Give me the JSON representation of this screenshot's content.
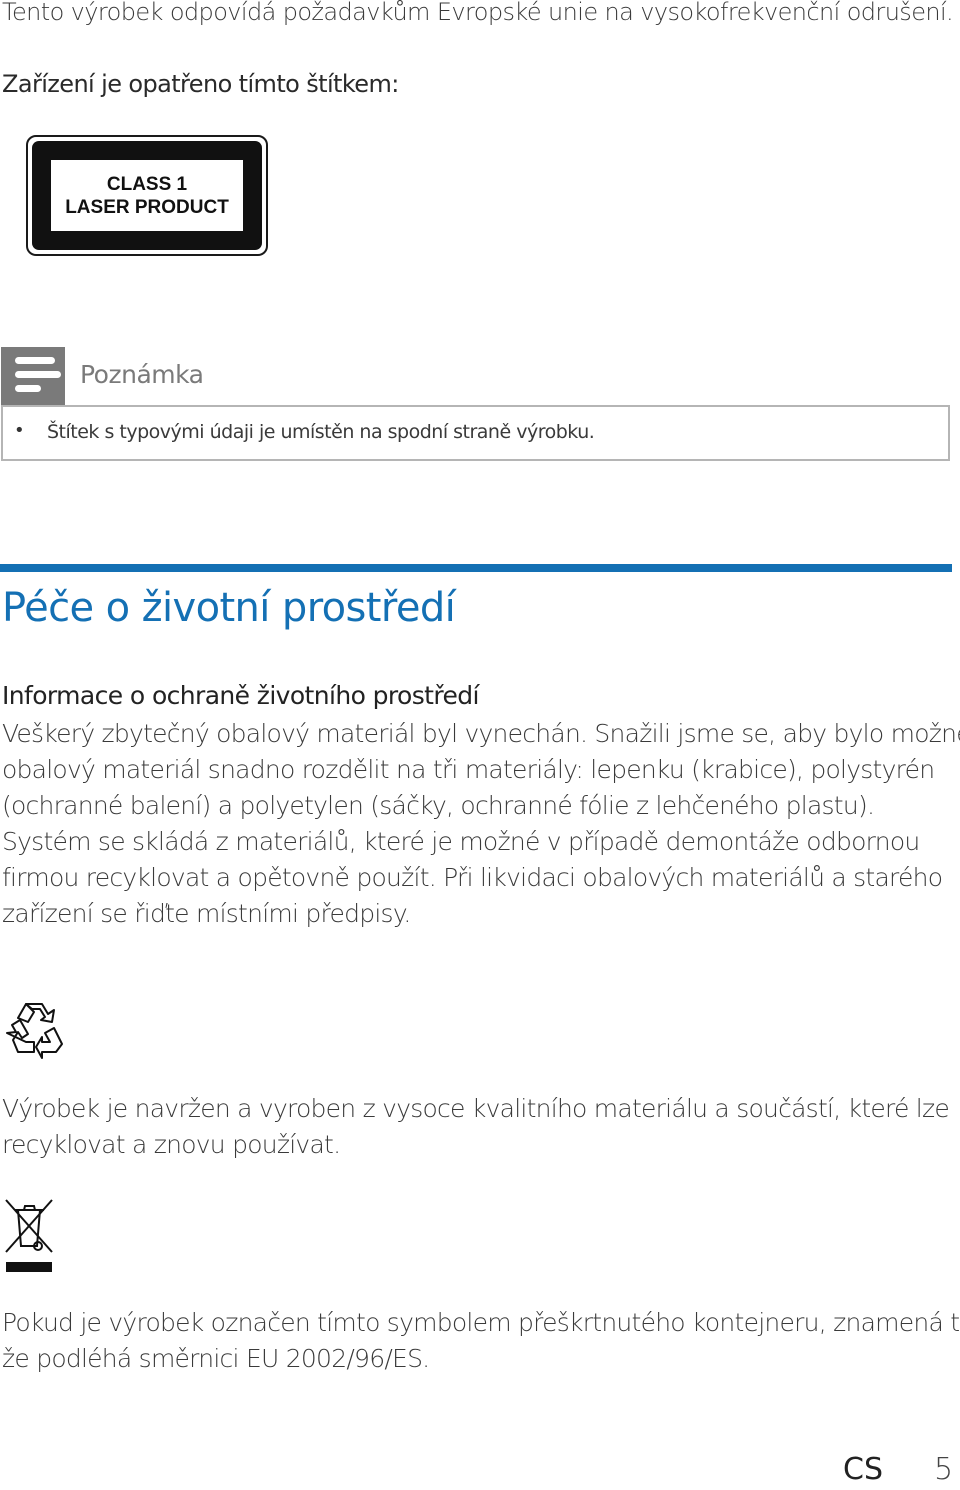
{
  "intro": {
    "emc_statement": "Tento výrobek odpovídá požadavkům Evropské unie na vysokofrekvenční odrušení.",
    "label_statement": "Zařízení je opatřeno tímto štítkem:"
  },
  "laser_label": {
    "line1": "CLASS 1",
    "line2": "LASER PRODUCT"
  },
  "note": {
    "icon": "note-icon",
    "title": "Poznámka",
    "bullet": "•",
    "items": [
      "Štítek s typovými údaji je umístěn na spodní straně výrobku."
    ]
  },
  "section": {
    "accent_color": "#1470b4",
    "title": "Péče o životní prostředí",
    "subheading": "Informace o ochraně životního prostředí",
    "paragraph1_lines": [
      "Veškerý zbytečný obalový materiál byl vynechán. Snažili jsme se, aby bylo možné",
      "obalový materiál snadno rozdělit na tři materiály: lepenku (krabice), polystyrén",
      "(ochranné balení) a polyetylen (sáčky, ochranné fólie z lehčeného plastu).",
      "Systém se skládá z materiálů, které je možné v případě demontáže odbornou",
      "firmou recyklovat a opětovně použít. Při likvidaci obalových materiálů a starého",
      "zařízení se řiďte místními předpisy."
    ],
    "recycle_icon": "recycle-icon",
    "paragraph2_lines": [
      "Výrobek je navržen a vyroben z vysoce kvalitního materiálu a součástí, které lze",
      "recyklovat a znovu používat."
    ],
    "weee_icon": "crossed-out-bin-icon",
    "paragraph3_lines": [
      "Pokud je výrobek označen tímto symbolem přeškrtnutého kontejneru, znamená to,",
      "že podléhá směrnici EU 2002/96/ES."
    ]
  },
  "footer": {
    "language": "CS",
    "page_number": "5"
  }
}
